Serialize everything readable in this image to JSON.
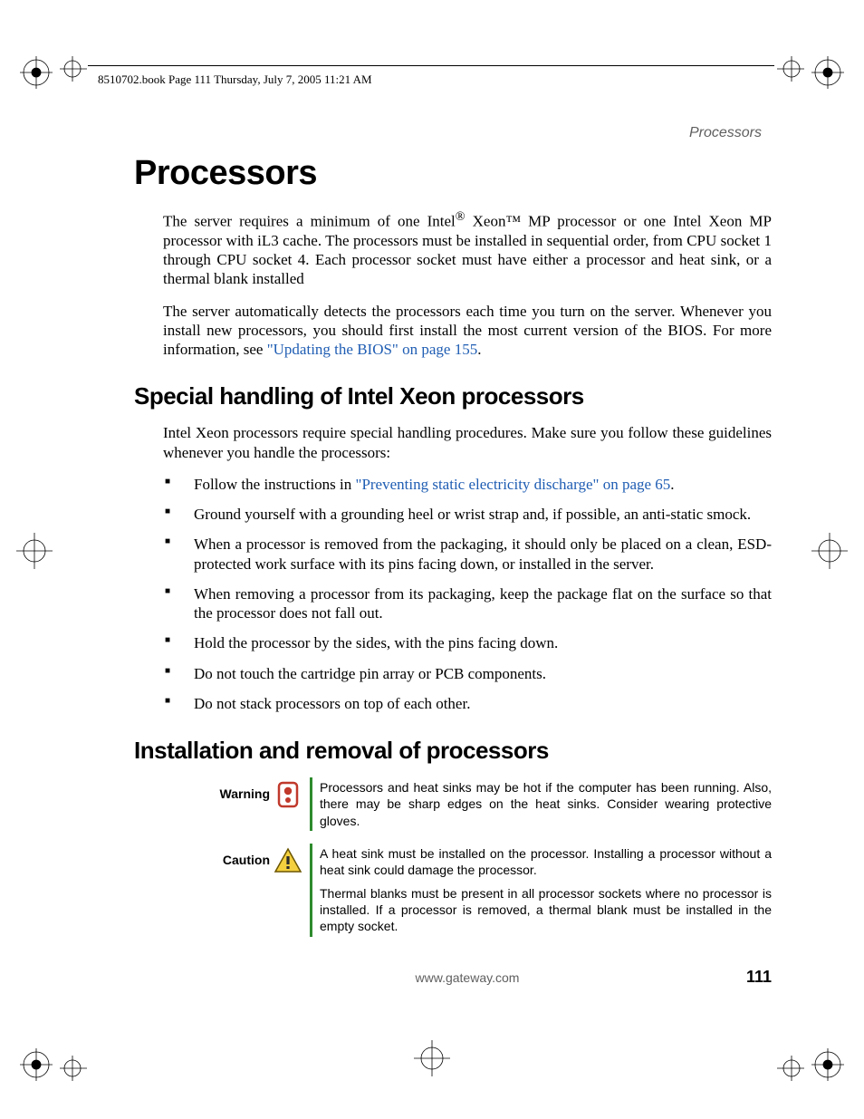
{
  "print": {
    "header": "8510702.book  Page 111  Thursday, July 7, 2005  11:21 AM"
  },
  "running_head": "Processors",
  "title": "Processors",
  "intro_para1_pre": "The server requires a minimum of one Intel",
  "intro_para1_mid": " Xeon™ MP processor or one Intel Xeon MP processor with iL3 cache. The processors must be installed in sequential order, from CPU socket 1 through CPU socket 4. Each processor socket must have either a processor and heat sink, or a thermal blank installed",
  "intro_para2_pre": "The server automatically detects the processors each time you turn on the server. Whenever you install new processors, you should first install the most current version of the BIOS. For more information, see ",
  "intro_para2_link": "\"Updating the BIOS\" on page 155",
  "intro_para2_post": ".",
  "section1": {
    "title": "Special handling of Intel Xeon processors",
    "lead": "Intel Xeon processors require special handling procedures. Make sure you follow these guidelines whenever you handle the processors:",
    "bullets": {
      "b0_pre": "Follow the instructions in ",
      "b0_link": "\"Preventing static electricity discharge\" on page 65",
      "b0_post": ".",
      "b1": "Ground yourself with a grounding heel or wrist strap and, if possible, an anti-static smock.",
      "b2": "When a processor is removed from the packaging, it should only be placed on a clean, ESD-protected work surface with its pins facing down, or installed in the server.",
      "b3": "When removing a processor from its packaging, keep the package flat on the surface so that the processor does not fall out.",
      "b4": "Hold the processor by the sides, with the pins facing down.",
      "b5": "Do not touch the cartridge pin array or PCB components.",
      "b6": "Do not stack processors on top of each other."
    }
  },
  "section2": {
    "title": "Installation and removal of processors",
    "warning_label": "Warning",
    "warning_text": "Processors and heat sinks may be hot if the computer has been running. Also, there may be sharp edges on the heat sinks. Consider wearing protective gloves.",
    "caution_label": "Caution",
    "caution_text1": "A heat sink must be installed on the processor. Installing a processor without a heat sink could damage the processor.",
    "caution_text2": "Thermal blanks must be present in all processor sockets where no processor is installed. If a processor is removed, a thermal blank must be installed in the empty socket."
  },
  "footer": {
    "url": "www.gateway.com",
    "page": "111"
  }
}
